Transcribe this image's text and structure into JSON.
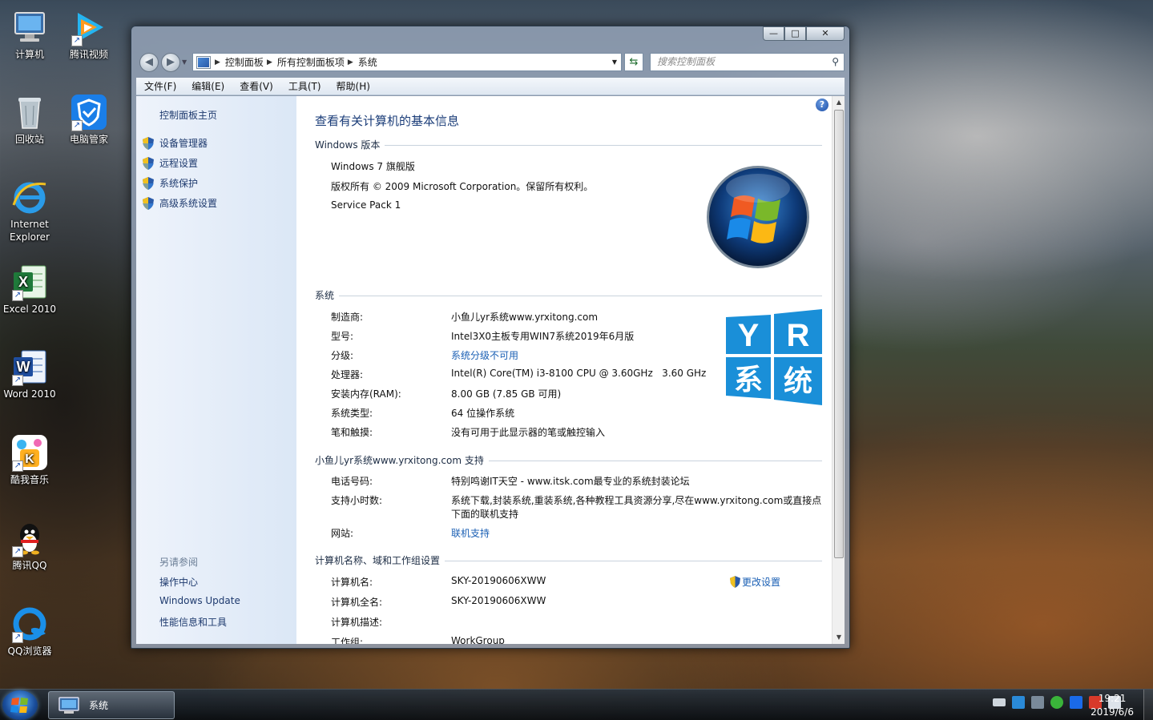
{
  "desktop": {
    "icons": [
      {
        "label": "计算机"
      },
      {
        "label": "腾讯视频"
      },
      {
        "label": "回收站"
      },
      {
        "label": "电脑管家"
      },
      {
        "label": "Internet Explorer"
      },
      {
        "label": "Excel 2010"
      },
      {
        "label": "Word 2010"
      },
      {
        "label": "酷我音乐"
      },
      {
        "label": "腾讯QQ"
      },
      {
        "label": "QQ浏览器"
      }
    ]
  },
  "window": {
    "title_buttons": {
      "minimize": "—",
      "maximize": "□",
      "close": "✕"
    },
    "breadcrumb": [
      "控制面板",
      "所有控制面板项",
      "系统"
    ],
    "search_placeholder": "搜索控制面板",
    "menu": [
      "文件(F)",
      "编辑(E)",
      "查看(V)",
      "工具(T)",
      "帮助(H)"
    ],
    "sidebar": {
      "home": "控制面板主页",
      "tasks": [
        "设备管理器",
        "远程设置",
        "系统保护",
        "高级系统设置"
      ],
      "see_also_title": "另请参阅",
      "see_also": [
        "操作中心",
        "Windows Update",
        "性能信息和工具"
      ]
    },
    "main": {
      "title": "查看有关计算机的基本信息",
      "edition": {
        "heading": "Windows 版本",
        "name": "Windows 7 旗舰版",
        "copyright": "版权所有 © 2009 Microsoft Corporation。保留所有权利。",
        "service_pack": "Service Pack 1"
      },
      "system": {
        "heading": "系统",
        "rows": [
          {
            "label": "制造商:",
            "value": "小鱼儿yr系统www.yrxitong.com"
          },
          {
            "label": "型号:",
            "value": "Intel3X0主板专用WIN7系统2019年6月版"
          },
          {
            "label": "分级:",
            "value": "系统分级不可用"
          },
          {
            "label": "处理器:",
            "value": "Intel(R) Core(TM) i3-8100 CPU @ 3.60GHz   3.60 GHz"
          },
          {
            "label": "安装内存(RAM):",
            "value": "8.00 GB (7.85 GB 可用)"
          },
          {
            "label": "系统类型:",
            "value": "64 位操作系统"
          },
          {
            "label": "笔和触摸:",
            "value": "没有可用于此显示器的笔或触控输入"
          }
        ]
      },
      "support": {
        "heading": "小鱼儿yr系统www.yrxitong.com 支持",
        "rows": [
          {
            "label": "电话号码:",
            "value": "特别鸣谢IT天空 - www.itsk.com最专业的系统封装论坛"
          },
          {
            "label": "支持小时数:",
            "value": "系统下载,封装系统,重装系统,各种教程工具资源分享,尽在www.yrxitong.com或直接点",
            "value2": "下面的联机支持"
          },
          {
            "label": "网站:",
            "value": "联机支持"
          }
        ]
      },
      "computer": {
        "heading": "计算机名称、域和工作组设置",
        "change_label": "更改设置",
        "rows": [
          {
            "label": "计算机名:",
            "value": "SKY-20190606XWW"
          },
          {
            "label": "计算机全名:",
            "value": "SKY-20190606XWW"
          },
          {
            "label": "计算机描述:",
            "value": ""
          },
          {
            "label": "工作组:",
            "value": "WorkGroup"
          }
        ]
      },
      "yr_logo": {
        "t1": "Y",
        "t2": "R",
        "t3": "系",
        "t4": "统"
      }
    }
  },
  "taskbar": {
    "active_task": "系统",
    "time": "19:21",
    "date": "2019/6/6"
  },
  "colors": {
    "link": "#1a5fb4",
    "title": "#1a3c78",
    "yr_blue": "#1a8fd8"
  }
}
